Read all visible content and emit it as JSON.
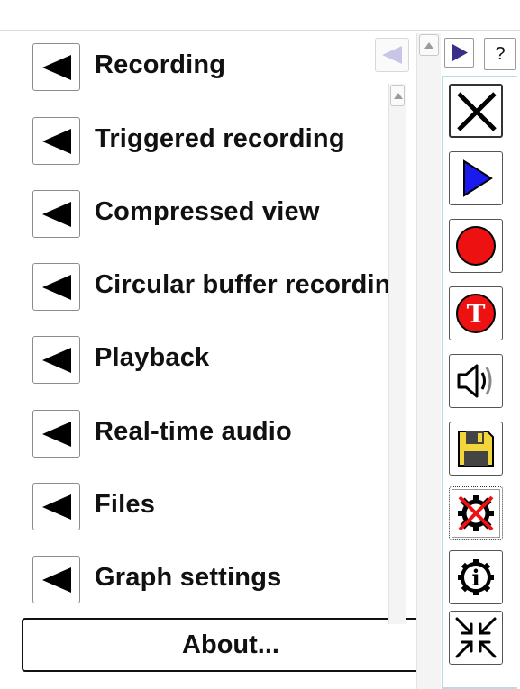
{
  "menu": {
    "items": [
      {
        "label": "Recording"
      },
      {
        "label": "Triggered recording"
      },
      {
        "label": "Compressed view"
      },
      {
        "label": "Circular buffer recording"
      },
      {
        "label": "Playback"
      },
      {
        "label": "Real-time audio"
      },
      {
        "label": "Files"
      },
      {
        "label": "Graph settings"
      }
    ],
    "about_label": "About..."
  },
  "nav": {
    "help_label": "?"
  },
  "toolbar": {
    "tools": [
      {
        "icon": "close-x-icon"
      },
      {
        "icon": "play-icon"
      },
      {
        "icon": "record-icon"
      },
      {
        "icon": "triggered-record-icon",
        "badge": "T"
      },
      {
        "icon": "speaker-icon"
      },
      {
        "icon": "save-floppy-icon"
      },
      {
        "icon": "settings-disabled-icon"
      },
      {
        "icon": "info-icon",
        "badge": "i"
      },
      {
        "icon": "compress-arrows-icon"
      }
    ]
  },
  "colors": {
    "play": "#1a1aee",
    "record": "#ee1111",
    "floppy": "#f2d63a",
    "nav_arrow": "#3a2f86",
    "panel_border": "#b9dbe6"
  }
}
